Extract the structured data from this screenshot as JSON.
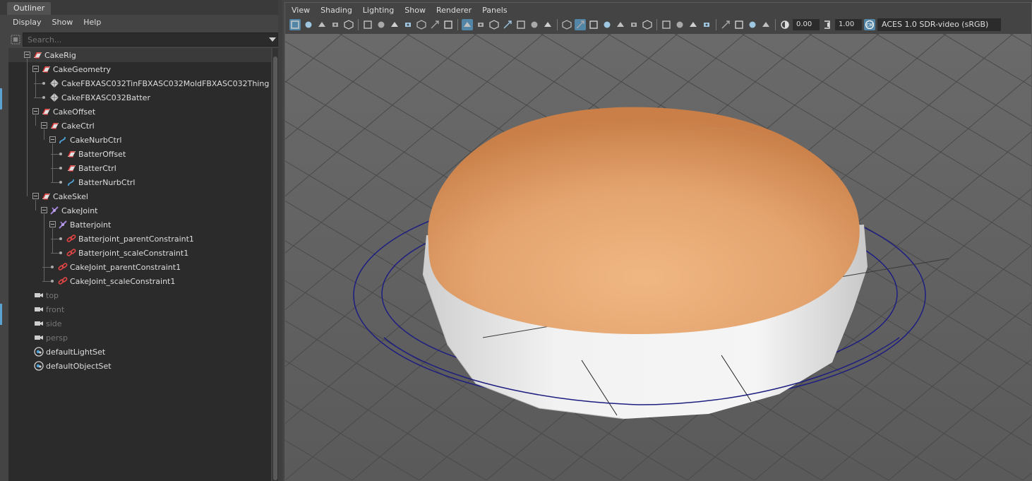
{
  "outliner": {
    "tab_label": "Outliner",
    "menu": [
      "Display",
      "Show",
      "Help"
    ],
    "search_placeholder": "Search...",
    "nodes": [
      {
        "label": "CakeRig",
        "depth": 0,
        "type": "transform",
        "expanded": true,
        "selected": true
      },
      {
        "label": "CakeGeometry",
        "depth": 1,
        "type": "transform",
        "expanded": true
      },
      {
        "label": "CakeFBXASC032TinFBXASC032MoldFBXASC032Thing",
        "depth": 2,
        "type": "mesh"
      },
      {
        "label": "CakeFBXASC032Batter",
        "depth": 2,
        "type": "mesh"
      },
      {
        "label": "CakeOffset",
        "depth": 1,
        "type": "transform",
        "expanded": true
      },
      {
        "label": "CakeCtrl",
        "depth": 2,
        "type": "transform",
        "expanded": true
      },
      {
        "label": "CakeNurbCtrl",
        "depth": 3,
        "type": "curve",
        "expanded": true
      },
      {
        "label": "BatterOffset",
        "depth": 4,
        "type": "transform"
      },
      {
        "label": "BatterCtrl",
        "depth": 4,
        "type": "transform"
      },
      {
        "label": "BatterNurbCtrl",
        "depth": 4,
        "type": "curve"
      },
      {
        "label": "CakeSkel",
        "depth": 1,
        "type": "transform",
        "expanded": true
      },
      {
        "label": "CakeJoint",
        "depth": 2,
        "type": "joint",
        "expanded": true
      },
      {
        "label": "Batterjoint",
        "depth": 3,
        "type": "joint",
        "expanded": true
      },
      {
        "label": "Batterjoint_parentConstraint1",
        "depth": 4,
        "type": "constraint"
      },
      {
        "label": "Batterjoint_scaleConstraint1",
        "depth": 4,
        "type": "constraint"
      },
      {
        "label": "CakeJoint_parentConstraint1",
        "depth": 3,
        "type": "constraint"
      },
      {
        "label": "CakeJoint_scaleConstraint1",
        "depth": 3,
        "type": "constraint"
      },
      {
        "label": "top",
        "depth": 0,
        "type": "camera",
        "dim": true
      },
      {
        "label": "front",
        "depth": 0,
        "type": "camera",
        "dim": true
      },
      {
        "label": "side",
        "depth": 0,
        "type": "camera",
        "dim": true
      },
      {
        "label": "persp",
        "depth": 0,
        "type": "camera",
        "dim": true
      },
      {
        "label": "defaultLightSet",
        "depth": 0,
        "type": "set"
      },
      {
        "label": "defaultObjectSet",
        "depth": 0,
        "type": "set"
      }
    ]
  },
  "viewport": {
    "menu": [
      "View",
      "Shading",
      "Lighting",
      "Show",
      "Renderer",
      "Panels"
    ],
    "exposure": "0.00",
    "gamma": "1.00",
    "color_space": "ACES 1.0 SDR-video (sRGB)",
    "toolbar_icons": [
      "select-camera-icon",
      "camera-attributes-icon",
      "bookmarks-icon",
      "image-plane-icon",
      "2d-pan-icon",
      "sep",
      "grease-pencil-icon",
      "camera-tools-icon",
      "film-gate-icon",
      "resolution-gate-icon",
      "gate-mask-icon",
      "field-chart-icon",
      "safe-action-icon",
      "sep",
      "grid-icon",
      "gate-icon",
      "safe-title-icon",
      "resolution-icon",
      "overscan-icon",
      "field-icon",
      "safe-frame-icon",
      "sep",
      "wireframe-icon",
      "smooth-shade-icon",
      "wire-on-shaded-icon",
      "textured-icon",
      "lights-icon",
      "shadows-icon",
      "ambient-occlusion-icon",
      "sep",
      "motion-blur-icon",
      "anti-alias-icon",
      "dof-icon",
      "xray-icon",
      "sep",
      "isolate-select-icon",
      "xray-joints-icon",
      "xray-active-icon",
      "backface-icon"
    ],
    "colors": {
      "cake_top": "#e2a06d",
      "cake_tin": "#e9e9e9",
      "ctrl_curve": "#1a1a8a",
      "active_tool": "#5285a6"
    }
  }
}
